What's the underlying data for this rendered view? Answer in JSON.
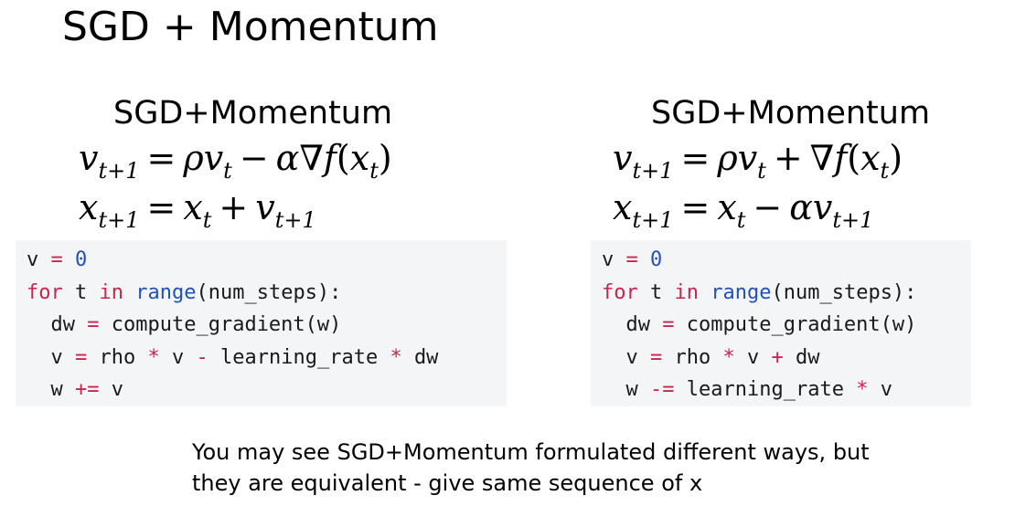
{
  "title": "SGD + Momentum",
  "left": {
    "heading": "SGD+Momentum",
    "formula1": {
      "lhs_var": "v",
      "lhs_sub": "t+1",
      "eq": "=",
      "rho": "ρ",
      "v": "v",
      "v_sub": "t",
      "minus": "−",
      "alpha_grad": "α∇f",
      "paren_open": "(",
      "x": "x",
      "x_sub": "t",
      "paren_close": ")"
    },
    "formula2": {
      "lhs_var": "x",
      "lhs_sub": "t+1",
      "eq": "=",
      "x": "x",
      "x_sub": "t",
      "plus": "+",
      "v": "v",
      "v_sub": "t+1"
    },
    "code": {
      "l1_var": "v",
      "l1_op": "=",
      "l1_num": "0",
      "l2_for": "for",
      "l2_t": "t",
      "l2_in": "in",
      "l2_range": "range",
      "l2_rest": "(num_steps):",
      "l3_dw": "dw",
      "l3_op": "=",
      "l3_call": "compute_gradient(w)",
      "l4_v": "v",
      "l4_eq": "=",
      "l4_rho": "rho",
      "l4_mul": "*",
      "l4_v2": "v",
      "l4_minus": "-",
      "l4_lr": "learning_rate",
      "l4_mul2": "*",
      "l4_dw": "dw",
      "l5_w": "w",
      "l5_op": "+=",
      "l5_v": "v"
    }
  },
  "right": {
    "heading": "SGD+Momentum",
    "formula1": {
      "lhs_var": "v",
      "lhs_sub": "t+1",
      "eq": "=",
      "rho": "ρ",
      "v": "v",
      "v_sub": "t",
      "plus": "+",
      "grad": "∇f",
      "paren_open": "(",
      "x": "x",
      "x_sub": "t",
      "paren_close": ")"
    },
    "formula2": {
      "lhs_var": "x",
      "lhs_sub": "t+1",
      "eq": "=",
      "x": "x",
      "x_sub": "t",
      "minus": "−",
      "alpha": "α",
      "v": "v",
      "v_sub": "t+1"
    },
    "code": {
      "l1_var": "v",
      "l1_op": "=",
      "l1_num": "0",
      "l2_for": "for",
      "l2_t": "t",
      "l2_in": "in",
      "l2_range": "range",
      "l2_rest": "(num_steps):",
      "l3_dw": "dw",
      "l3_op": "=",
      "l3_call": "compute_gradient(w)",
      "l4_v": "v",
      "l4_eq": "=",
      "l4_rho": "rho",
      "l4_mul": "*",
      "l4_v2": "v",
      "l4_plus": "+",
      "l4_dw": "dw",
      "l5_w": "w",
      "l5_op": "-=",
      "l5_lr": "learning_rate",
      "l5_mul": "*",
      "l5_v": "v"
    }
  },
  "caption": {
    "line1": "You may see SGD+Momentum formulated different ways, but",
    "line2": "they are equivalent - give same sequence of x"
  },
  "colors": {
    "keyword": "#c7254e",
    "builtin": "#2450b8",
    "code_background": "#f4f5f6"
  }
}
